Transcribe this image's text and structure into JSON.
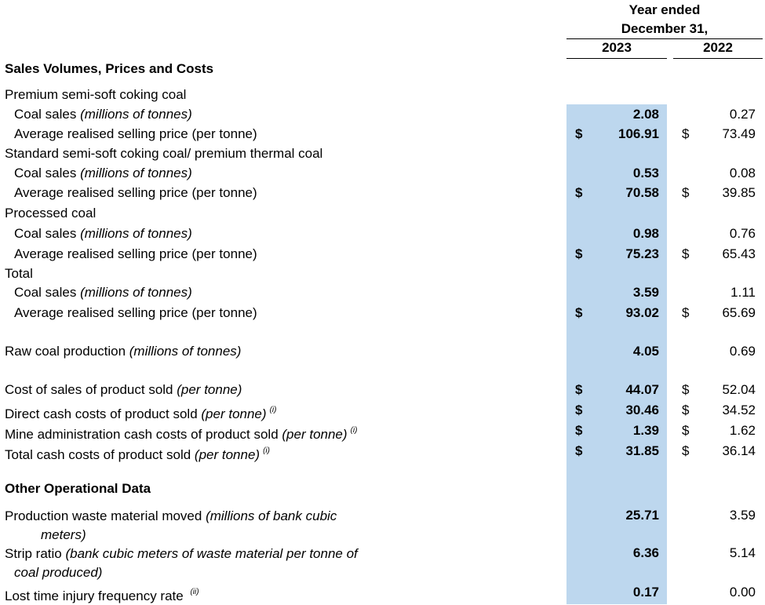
{
  "header": {
    "line1": "Year ended",
    "line2": "December 31,",
    "year_current": "2023",
    "year_prior": "2022"
  },
  "sections": {
    "sales": "Sales Volumes, Prices and Costs",
    "other": "Other Operational Data"
  },
  "rows": [
    {
      "label": "Premium semi-soft coking coal",
      "italic": "",
      "sup": "",
      "cur": "",
      "v2023": "",
      "v2022": ""
    },
    {
      "label": "Coal sales ",
      "italic": "(millions of tonnes)",
      "sup": "",
      "cur": "",
      "v2023": "2.08",
      "v2022": "0.27"
    },
    {
      "label": "Average realised selling price (per tonne)",
      "italic": "",
      "sup": "",
      "cur": "$",
      "v2023": "106.91",
      "v2022": "73.49"
    },
    {
      "label": "Standard semi-soft coking coal/ premium thermal coal",
      "italic": "",
      "sup": "",
      "cur": "",
      "v2023": "",
      "v2022": ""
    },
    {
      "label": "Coal sales ",
      "italic": "(millions of tonnes)",
      "sup": "",
      "cur": "",
      "v2023": "0.53",
      "v2022": "0.08"
    },
    {
      "label": "Average realised selling price (per tonne)",
      "italic": "",
      "sup": "",
      "cur": "$",
      "v2023": "70.58",
      "v2022": "39.85"
    },
    {
      "label": "Processed coal",
      "italic": "",
      "sup": "",
      "cur": "",
      "v2023": "",
      "v2022": ""
    },
    {
      "label": "Coal sales ",
      "italic": "(millions of tonnes)",
      "sup": "",
      "cur": "",
      "v2023": "0.98",
      "v2022": "0.76"
    },
    {
      "label": "Average realised selling price (per tonne)",
      "italic": "",
      "sup": "",
      "cur": "$",
      "v2023": "75.23",
      "v2022": "65.43"
    },
    {
      "label": "Total",
      "italic": "",
      "sup": "",
      "cur": "",
      "v2023": "",
      "v2022": ""
    },
    {
      "label": "Coal sales ",
      "italic": "(millions of tonnes)",
      "sup": "",
      "cur": "",
      "v2023": "3.59",
      "v2022": "1.11"
    },
    {
      "label": "Average realised selling price (per tonne)",
      "italic": "",
      "sup": "",
      "cur": "$",
      "v2023": "93.02",
      "v2022": "65.69"
    },
    {
      "label": "Raw coal production ",
      "italic": "(millions of tonnes)",
      "sup": "",
      "cur": "",
      "v2023": "4.05",
      "v2022": "0.69"
    },
    {
      "label": "Cost of sales of product sold ",
      "italic": "(per tonne)",
      "sup": "",
      "cur": "$",
      "v2023": "44.07",
      "v2022": "52.04"
    },
    {
      "label": "Direct cash costs of product sold ",
      "italic": "(per tonne)",
      "sup": "(i)",
      "cur": "$",
      "v2023": "30.46",
      "v2022": "34.52"
    },
    {
      "label": "Mine administration cash costs of product sold ",
      "italic": "(per tonne)",
      "sup": "(i)",
      "cur": "$",
      "v2023": "1.39",
      "v2022": "1.62"
    },
    {
      "label": "Total cash costs of product sold ",
      "italic": "(per tonne)",
      "sup": "(i)",
      "cur": "$",
      "v2023": "31.85",
      "v2022": "36.14"
    }
  ],
  "other_rows": [
    {
      "label": "Production waste material moved ",
      "italic": "(millions of bank cubic",
      "cont": "meters)",
      "sup": "",
      "v2023": "25.71",
      "v2022": "3.59"
    },
    {
      "label": "Strip ratio ",
      "italic": "(bank cubic meters of waste material per tonne of",
      "cont": "coal produced)",
      "sup": "",
      "v2023": "6.36",
      "v2022": "5.14"
    },
    {
      "label": "Lost time injury frequency rate ",
      "italic": "",
      "cont": "",
      "sup": "(ii)",
      "v2023": "0.17",
      "v2022": "0.00"
    }
  ]
}
